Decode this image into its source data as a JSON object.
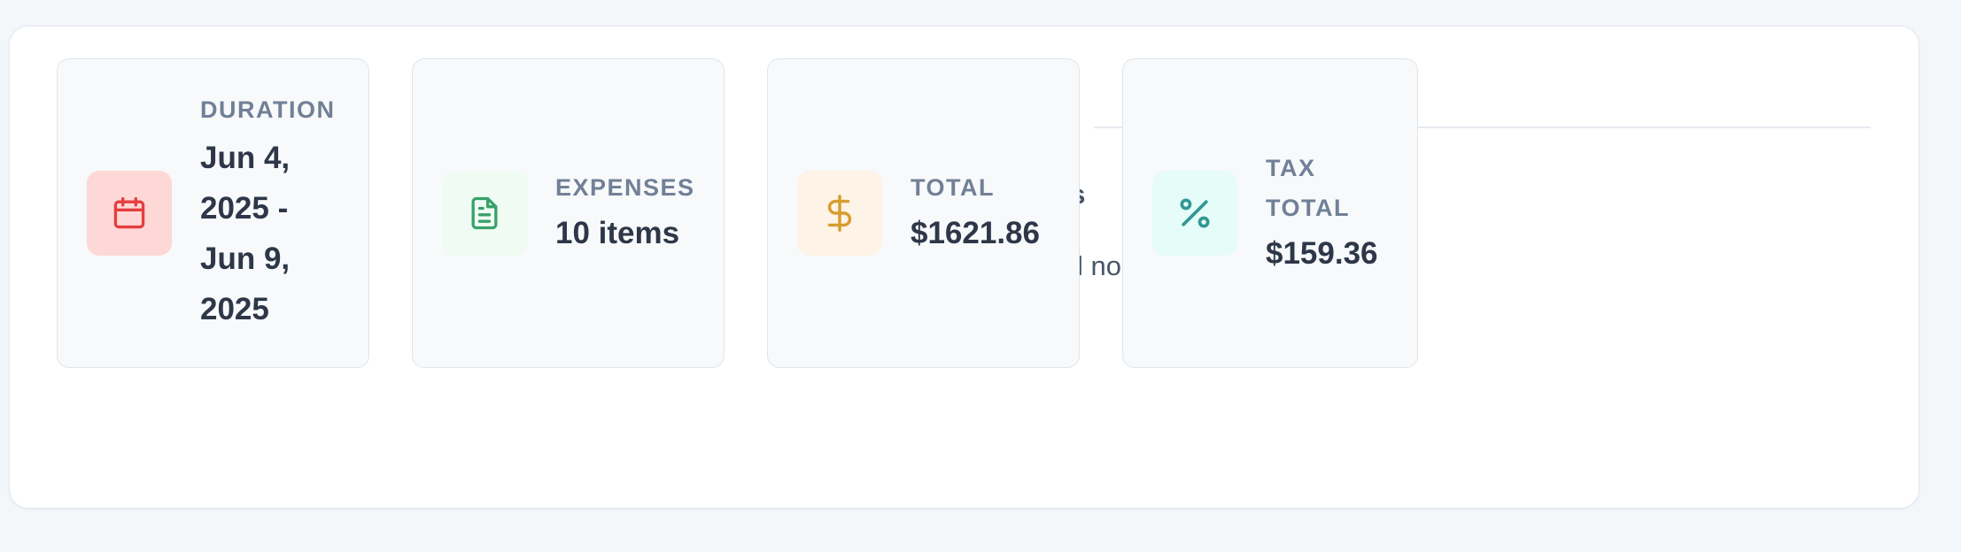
{
  "background": {
    "heading_fragment": "es",
    "text_fragment": "l no"
  },
  "cards": [
    {
      "icon": "calendar-icon",
      "label": "DURATION",
      "value": "Jun 4, 2025 - Jun 9, 2025",
      "color": "#e53e3e",
      "tint": "#fed7d7"
    },
    {
      "icon": "document-icon",
      "label": "EXPENSES",
      "value": "10 items",
      "color": "#38a169",
      "tint": "#effbf3"
    },
    {
      "icon": "dollar-icon",
      "label": "TOTAL",
      "value": "$1621.86",
      "color": "#d69e2e",
      "tint": "#fdf3e6"
    },
    {
      "icon": "percent-icon",
      "label": "TAX TOTAL",
      "value": "$159.36",
      "color": "#319795",
      "tint": "#e6fcf8"
    }
  ]
}
